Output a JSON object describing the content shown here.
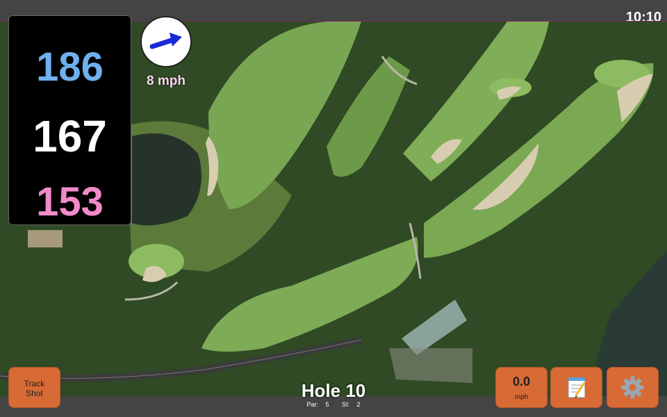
{
  "status_bar": {
    "time": "10:10"
  },
  "yardages": {
    "back": "186",
    "middle": "167",
    "front": "153"
  },
  "wind": {
    "speed": "8 mph",
    "direction_icon": "arrow-east-icon"
  },
  "hole": {
    "title": "Hole 10",
    "par_label": "Par:",
    "par": "5",
    "si_label": "SI:",
    "si": "2"
  },
  "buttons": {
    "track_shot_line1": "Track",
    "track_shot_line2": "Shot",
    "speed_value": "0.0",
    "speed_unit": "mph",
    "notes_icon": "notepad-icon",
    "settings_icon": "gear-icon"
  },
  "colors": {
    "button": "#d86a36",
    "back_yd": "#6fb0ee",
    "front_yd": "#f28ac8"
  }
}
